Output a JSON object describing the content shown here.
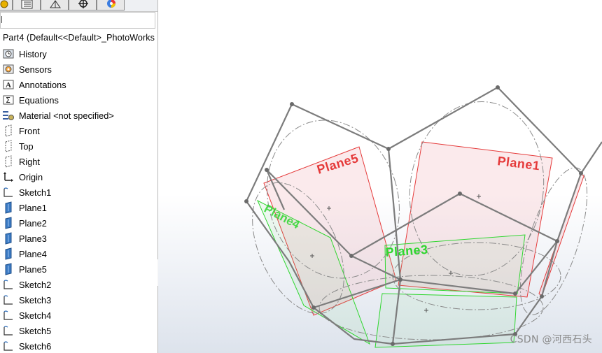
{
  "part": {
    "title": "Part4  (Default<<Default>_PhotoWorks"
  },
  "tree": [
    {
      "label": "History",
      "icon": "history-icon"
    },
    {
      "label": "Sensors",
      "icon": "sensors-icon"
    },
    {
      "label": "Annotations",
      "icon": "annotations-icon"
    },
    {
      "label": "Equations",
      "icon": "equations-icon"
    },
    {
      "label": "Material <not specified>",
      "icon": "material-icon"
    },
    {
      "label": "Front",
      "icon": "plane-outline-icon"
    },
    {
      "label": "Top",
      "icon": "plane-outline-icon"
    },
    {
      "label": "Right",
      "icon": "plane-outline-icon"
    },
    {
      "label": "Origin",
      "icon": "origin-icon"
    },
    {
      "label": "Sketch1",
      "icon": "sketch-icon"
    },
    {
      "label": "Plane1",
      "icon": "plane-icon"
    },
    {
      "label": "Plane2",
      "icon": "plane-icon"
    },
    {
      "label": "Plane3",
      "icon": "plane-icon"
    },
    {
      "label": "Plane4",
      "icon": "plane-icon"
    },
    {
      "label": "Plane5",
      "icon": "plane-icon"
    },
    {
      "label": "Sketch2",
      "icon": "sketch-icon"
    },
    {
      "label": "Sketch3",
      "icon": "sketch-icon"
    },
    {
      "label": "Sketch4",
      "icon": "sketch-icon"
    },
    {
      "label": "Sketch5",
      "icon": "sketch-icon"
    },
    {
      "label": "Sketch6",
      "icon": "sketch-icon"
    }
  ],
  "viewport": {
    "plane_labels": {
      "plane1": "Plane1",
      "plane3": "Plane3",
      "plane4": "Plane4",
      "plane5": "Plane5"
    },
    "colors": {
      "selected_plane": "#e53a3a",
      "plane_highlight": "#2fd62f",
      "edge": "#7a7a7a"
    }
  },
  "watermark": "CSDN @河西石头"
}
